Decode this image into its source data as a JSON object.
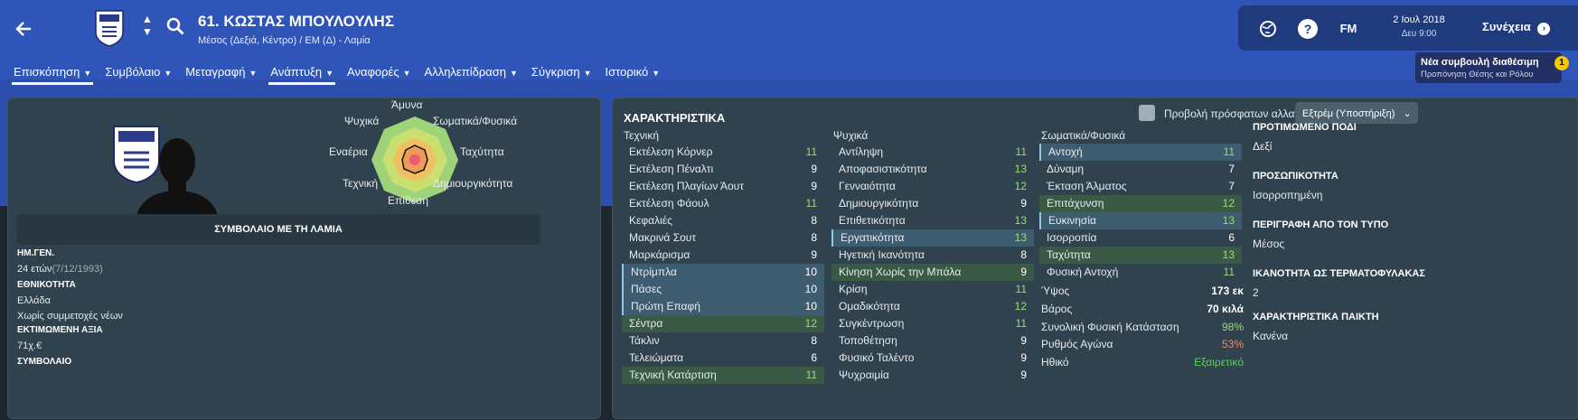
{
  "header": {
    "title": "61. ΚΩΣΤΑΣ ΜΠΟΥΛΟΥΛΗΣ",
    "subtitle": "Μέσος (Δεξιά, Κέντρο) / ΕΜ (Δ) - Λαμία"
  },
  "nav": [
    {
      "label": "Επισκόπηση",
      "active": true
    },
    {
      "label": "Συμβόλαιο"
    },
    {
      "label": "Μεταγραφή"
    },
    {
      "label": "Ανάπτυξη",
      "active": true
    },
    {
      "label": "Αναφορές"
    },
    {
      "label": "Αλληλεπίδραση"
    },
    {
      "label": "Σύγκριση"
    },
    {
      "label": "Ιστορικό"
    }
  ],
  "top": {
    "fm": "FM",
    "date": "2 Ιουλ 2018",
    "time": "Δευ 9:00",
    "continue": "Συνέχεια",
    "news_title": "Νέα συμβουλή διαθέσιμη",
    "news_sub": "Προπόνηση Θέσης και Ρόλου",
    "badge": "1"
  },
  "left": {
    "contract_bar": "ΣΥΜΒΟΛΑΙΟ ΜΕ ΤΗ ΛΑΜΙΑ",
    "dob_label": "ΗΜ.ΓΕΝ.",
    "age": "24 ετών",
    "dob": "(7/12/1993)",
    "nat_label": "ΕΘΝΙΚΟΤΗΤΑ",
    "nat": "Ελλάδα",
    "youth": "Χωρίς συμμετοχές νέων",
    "value_label": "ΕΚΤΙΜΩΜΕΝΗ ΑΞΙΑ",
    "value": "71χ.€",
    "contract_label": "ΣΥΜΒΟΛΑΙΟ",
    "radar": [
      "Άμυνα",
      "Σωματικά/Φυσικά",
      "Ταχύτητα",
      "Δημιουργικότητα",
      "Επίθεση",
      "Τεχνική",
      "Εναέρια",
      "Ψυχικά"
    ]
  },
  "attributes": {
    "title": "ΧΑΡΑΚΤΗΡΙΣΤΙΚΑ",
    "toggle": "Προβολή πρόσφατων αλλαγών στα χαρακτηριστικά",
    "dropdown": "Εξτρέμ (Υποστήριξη)",
    "technical_header": "Τεχνική",
    "mental_header": "Ψυχικά",
    "physical_header": "Σωματικά/Φυσικά",
    "technical": [
      [
        "Εκτέλεση Κόρνερ",
        "11",
        "n"
      ],
      [
        "Εκτέλεση Πέναλτι",
        "9",
        "n"
      ],
      [
        "Εκτέλεση Πλαγίων Άουτ",
        "9",
        "n"
      ],
      [
        "Εκτέλεση Φάουλ",
        "11",
        "n"
      ],
      [
        "Κεφαλιές",
        "8",
        "n"
      ],
      [
        "Μακρινά Σουτ",
        "8",
        "n"
      ],
      [
        "Μαρκάρισμα",
        "9",
        "n"
      ],
      [
        "Ντρίμπλα",
        "10",
        "h"
      ],
      [
        "Πάσες",
        "10",
        "h"
      ],
      [
        "Πρώτη Επαφή",
        "10",
        "h"
      ],
      [
        "Σέντρα",
        "12",
        "g"
      ],
      [
        "Τάκλιν",
        "8",
        "n"
      ],
      [
        "Τελειώματα",
        "6",
        "n"
      ],
      [
        "Τεχνική Κατάρτιση",
        "11",
        "g"
      ]
    ],
    "mental": [
      [
        "Αντίληψη",
        "11",
        "n"
      ],
      [
        "Αποφασιστικότητα",
        "13",
        "n"
      ],
      [
        "Γενναιότητα",
        "12",
        "n"
      ],
      [
        "Δημιουργικότητα",
        "9",
        "n"
      ],
      [
        "Επιθετικότητα",
        "13",
        "n"
      ],
      [
        "Εργατικότητα",
        "13",
        "h"
      ],
      [
        "Ηγετική Ικανότητα",
        "8",
        "n"
      ],
      [
        "Κίνηση Χωρίς την Μπάλα",
        "9",
        "g"
      ],
      [
        "Κρίση",
        "11",
        "n"
      ],
      [
        "Ομαδικότητα",
        "12",
        "n"
      ],
      [
        "Συγκέντρωση",
        "11",
        "n"
      ],
      [
        "Τοποθέτηση",
        "9",
        "n"
      ],
      [
        "Φυσικό Ταλέντο",
        "9",
        "n"
      ],
      [
        "Ψυχραιμία",
        "9",
        "n"
      ]
    ],
    "physical": [
      [
        "Αντοχή",
        "11",
        "h"
      ],
      [
        "Δύναμη",
        "7",
        "n"
      ],
      [
        "Έκταση Άλματος",
        "7",
        "n"
      ],
      [
        "Επιτάχυνση",
        "12",
        "g"
      ],
      [
        "Ευκινησία",
        "13",
        "h"
      ],
      [
        "Ισορροπία",
        "6",
        "n"
      ],
      [
        "Ταχύτητα",
        "13",
        "g"
      ],
      [
        "Φυσική Αντοχή",
        "11",
        "n"
      ]
    ],
    "extra": [
      [
        "Ύψος",
        "173 εκ"
      ],
      [
        "Βάρος",
        "70 κιλά"
      ],
      [
        "Συνολική Φυσική Κατάσταση",
        "98%"
      ],
      [
        "Ρυθμός Αγώνα",
        "53%"
      ],
      [
        "Ηθικό",
        "Εξαιρετικό"
      ]
    ]
  },
  "profile": [
    [
      "ΠΡΟΤΙΜΩΜΕΝΟ ΠΟΔΙ",
      "Δεξί"
    ],
    [
      "ΠΡΟΣΩΠΙΚΟΤΗΤΑ",
      "Ισορροπημένη"
    ],
    [
      "ΠΕΡΙΓΡΑΦΗ ΑΠΟ ΤΟΝ ΤΥΠΟ",
      "Μέσος"
    ],
    [
      "ΙΚΑΝΟΤΗΤΑ ΩΣ ΤΕΡΜΑΤΟΦΥΛΑΚΑΣ",
      "2"
    ],
    [
      "ΧΑΡΑΚΤΗΡΙΣΤΙΚΑ ΠΑΙΚΤΗ",
      "Κανένα"
    ]
  ],
  "colors": {
    "header": "#2f55b8",
    "panel": "#30424d",
    "highlight": "#3e5c70",
    "green": "#3b5a45",
    "good": "#9bdc7a",
    "bad": "#f08870"
  }
}
